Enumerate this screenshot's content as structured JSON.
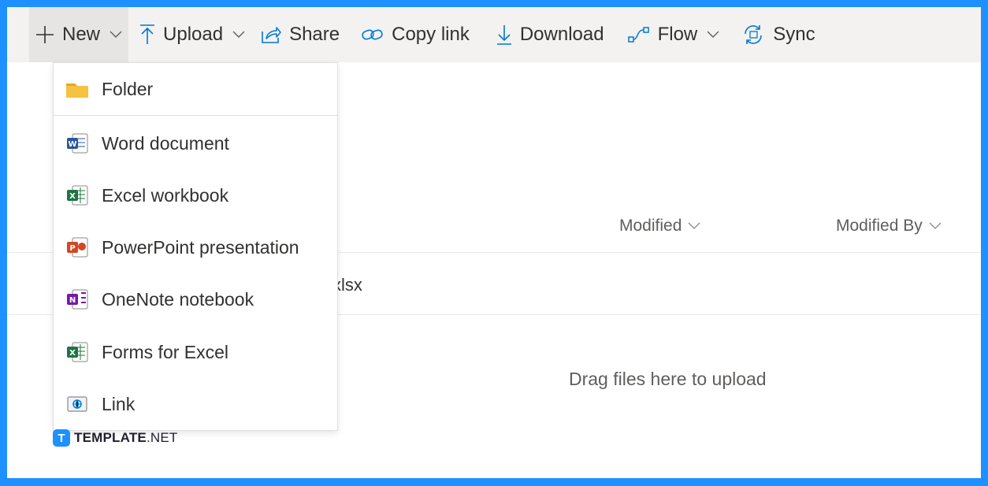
{
  "toolbar": {
    "new_label": "New",
    "upload_label": "Upload",
    "share_label": "Share",
    "copy_link_label": "Copy link",
    "download_label": "Download",
    "flow_label": "Flow",
    "sync_label": "Sync"
  },
  "new_menu": {
    "items": [
      {
        "label": "Folder",
        "icon": "folder-icon"
      },
      {
        "label": "Word document",
        "icon": "word-icon"
      },
      {
        "label": "Excel workbook",
        "icon": "excel-icon"
      },
      {
        "label": "PowerPoint presentation",
        "icon": "powerpoint-icon"
      },
      {
        "label": "OneNote notebook",
        "icon": "onenote-icon"
      },
      {
        "label": "Forms for Excel",
        "icon": "excel-icon"
      },
      {
        "label": "Link",
        "icon": "link-icon"
      }
    ]
  },
  "list": {
    "columns": {
      "modified": "Modified",
      "modified_by": "Modified By"
    },
    "rows": [
      {
        "name_fragment": "xlsx"
      }
    ],
    "drop_hint": "Drag files here to upload"
  },
  "watermark": {
    "badge": "T",
    "brand": "TEMPLATE",
    "suffix": ".NET"
  },
  "colors": {
    "frame": "#1e90ff",
    "command_bar": "#f3f2f1",
    "folder": "#f5c242",
    "word": "#2b579a",
    "excel": "#217346",
    "powerpoint": "#d24726",
    "onenote": "#7719aa",
    "link": "#0078d4"
  }
}
